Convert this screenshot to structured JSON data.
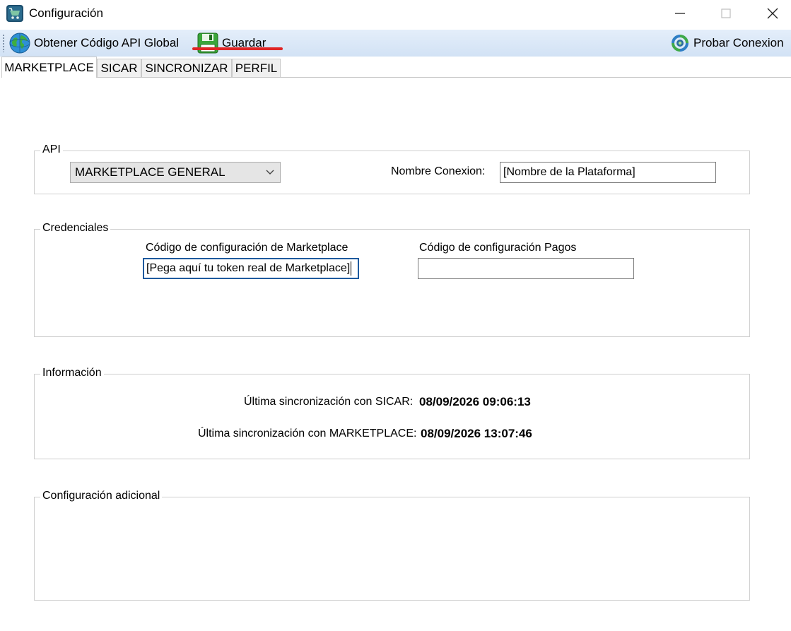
{
  "window": {
    "title": "Configuración"
  },
  "toolbar": {
    "global_api_label": "Obtener Código API Global",
    "save_label": "Guardar",
    "test_connection_label": "Probar Conexion"
  },
  "tabs": [
    {
      "label": "MARKETPLACE",
      "active": true
    },
    {
      "label": "SICAR",
      "active": false
    },
    {
      "label": "SINCRONIZAR",
      "active": false
    },
    {
      "label": "PERFIL",
      "active": false
    }
  ],
  "api_group": {
    "legend": "API",
    "selected_api": "MARKETPLACE GENERAL",
    "connection_name_label": "Nombre Conexion:",
    "connection_name_value": "[Nombre de la Plataforma]"
  },
  "credentials_group": {
    "legend": "Credenciales",
    "marketplace_code_label": "Código de configuración de Marketplace",
    "marketplace_code_value": "[Pega aquí tu token real de Marketplace]",
    "payments_code_label": "Código de configuración Pagos",
    "payments_code_value": ""
  },
  "info_group": {
    "legend": "Información",
    "last_sync_sicar_label": "Última sincronización con SICAR:",
    "last_sync_sicar_value": "08/09/2026 09:06:13",
    "last_sync_marketplace_label": "Última sincronización con MARKETPLACE:",
    "last_sync_marketplace_value": "08/09/2026 13:07:46"
  },
  "extra_group": {
    "legend": "Configuración adicional"
  },
  "colors": {
    "toolbar_bg": "#d9e6f6",
    "highlight_underline": "#e02525",
    "focus_border": "#1e5a9e"
  }
}
